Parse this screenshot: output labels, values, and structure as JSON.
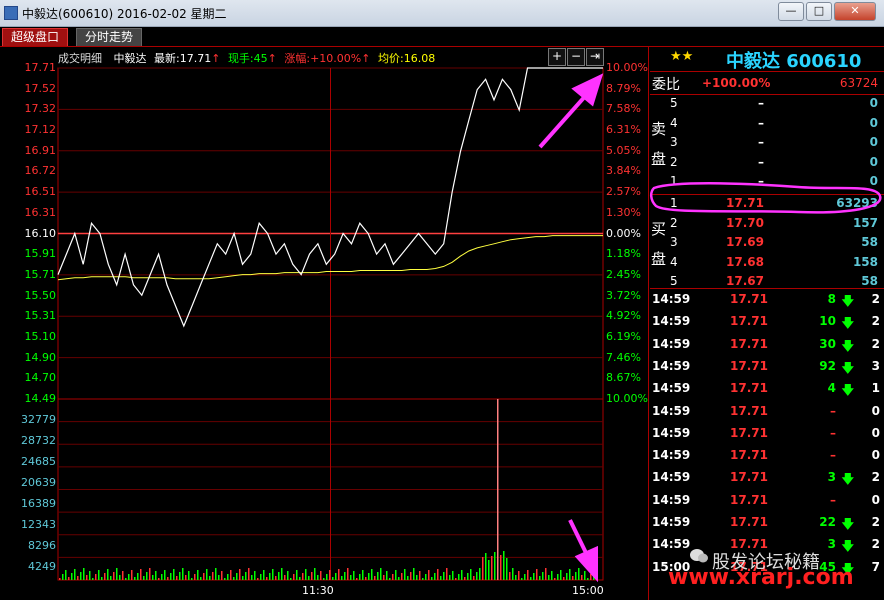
{
  "window": {
    "title": "中毅达(600610) 2016-02-02 星期二",
    "buttons": [
      "—",
      "□",
      "✕"
    ]
  },
  "tabs": [
    "超级盘口",
    "分时走势"
  ],
  "header": {
    "detail": "成交明细",
    "name": "中毅达",
    "latest_label": "最新:",
    "latest": "17.71",
    "vol_label": "现手:",
    "vol": "45",
    "chg_label": "涨幅:",
    "chg": "+10.00%",
    "avg_label": "均价:",
    "avg": "16.08",
    "controls": [
      "+",
      "−",
      "⇥"
    ]
  },
  "price_axis": [
    "17.71",
    "17.52",
    "17.32",
    "17.12",
    "16.91",
    "16.72",
    "16.51",
    "16.31",
    "16.10",
    "15.91",
    "15.71",
    "15.50",
    "15.31",
    "15.10",
    "14.90",
    "14.70",
    "14.49"
  ],
  "pct_axis": [
    "10.00%",
    "8.79%",
    "7.58%",
    "6.31%",
    "5.05%",
    "3.84%",
    "2.57%",
    "1.30%",
    "0.00%",
    "1.18%",
    "2.45%",
    "3.72%",
    "4.92%",
    "6.19%",
    "7.46%",
    "8.67%",
    "10.00%"
  ],
  "volume_axis": [
    "32779",
    "28732",
    "24685",
    "20639",
    "16389",
    "12343",
    "8296",
    "4249"
  ],
  "time_axis": [
    "11:30",
    "15:00"
  ],
  "chart_data": {
    "type": "line",
    "prev_close": 16.1,
    "ylim": [
      14.49,
      17.71
    ],
    "series": [
      {
        "values": [
          15.7,
          15.9,
          16.1,
          15.8,
          16.2,
          16.1,
          15.8,
          15.6,
          15.9,
          15.6,
          15.5,
          15.7,
          15.9,
          15.6,
          15.4,
          15.2,
          15.4,
          15.6,
          15.8,
          16.0,
          15.9,
          16.1,
          15.8,
          15.9,
          16.2,
          16.1,
          15.9,
          16.0,
          15.8,
          15.7,
          15.9,
          16.0,
          15.8,
          15.9,
          16.1,
          16.0,
          16.2,
          16.1,
          15.9,
          16.0,
          15.8,
          15.9,
          16.0,
          16.1,
          16.0,
          15.9,
          16.0,
          16.5,
          16.9,
          17.2,
          17.5,
          17.6,
          17.4,
          17.6,
          17.5,
          17.3,
          17.71,
          17.71,
          17.71,
          17.71,
          17.71,
          17.71,
          17.71,
          17.71,
          17.71,
          17.71
        ]
      },
      {
        "values": [
          15.65,
          15.66,
          15.67,
          15.67,
          15.68,
          15.68,
          15.68,
          15.68,
          15.68,
          15.67,
          15.67,
          15.67,
          15.67,
          15.67,
          15.66,
          15.66,
          15.66,
          15.66,
          15.66,
          15.67,
          15.68,
          15.69,
          15.7,
          15.7,
          15.71,
          15.71,
          15.71,
          15.72,
          15.72,
          15.72,
          15.72,
          15.72,
          15.73,
          15.73,
          15.73,
          15.73,
          15.74,
          15.74,
          15.74,
          15.74,
          15.74,
          15.74,
          15.75,
          15.75,
          15.75,
          15.76,
          15.78,
          15.82,
          15.88,
          15.93,
          15.96,
          15.98,
          16.0,
          16.02,
          16.04,
          16.05,
          16.06,
          16.07,
          16.07,
          16.08,
          16.08,
          16.08,
          16.08,
          16.08,
          16.08,
          16.08
        ]
      }
    ]
  },
  "quote": {
    "stars": "★★",
    "name_code": "中毅达 600610",
    "weibi_label": "委比",
    "weibi_pct": "+100.00%",
    "weibi_val": "63724",
    "sell_label": [
      "卖",
      "盘"
    ],
    "buy_label": [
      "买",
      "盘"
    ],
    "sell": [
      {
        "lvl": "5",
        "price": "–",
        "vol": "0"
      },
      {
        "lvl": "4",
        "price": "–",
        "vol": "0"
      },
      {
        "lvl": "3",
        "price": "–",
        "vol": "0"
      },
      {
        "lvl": "2",
        "price": "–",
        "vol": "0"
      },
      {
        "lvl": "1",
        "price": "–",
        "vol": "0"
      }
    ],
    "buy": [
      {
        "lvl": "1",
        "price": "17.71",
        "vol": "63293"
      },
      {
        "lvl": "2",
        "price": "17.70",
        "vol": "157"
      },
      {
        "lvl": "3",
        "price": "17.69",
        "vol": "58"
      },
      {
        "lvl": "4",
        "price": "17.68",
        "vol": "158"
      },
      {
        "lvl": "5",
        "price": "17.67",
        "vol": "58"
      }
    ]
  },
  "ticks": [
    {
      "time": "14:59",
      "price": "17.71",
      "vol": "8",
      "arrow": "down",
      "n": "2"
    },
    {
      "time": "14:59",
      "price": "17.71",
      "vol": "10",
      "arrow": "down",
      "n": "2"
    },
    {
      "time": "14:59",
      "price": "17.71",
      "vol": "30",
      "arrow": "down",
      "n": "2"
    },
    {
      "time": "14:59",
      "price": "17.71",
      "vol": "92",
      "arrow": "down",
      "n": "3"
    },
    {
      "time": "14:59",
      "price": "17.71",
      "vol": "4",
      "arrow": "down",
      "n": "1"
    },
    {
      "time": "14:59",
      "price": "17.71",
      "vol": "–",
      "arrow": "",
      "n": "0"
    },
    {
      "time": "14:59",
      "price": "17.71",
      "vol": "–",
      "arrow": "",
      "n": "0"
    },
    {
      "time": "14:59",
      "price": "17.71",
      "vol": "–",
      "arrow": "",
      "n": "0"
    },
    {
      "time": "14:59",
      "price": "17.71",
      "vol": "3",
      "arrow": "down",
      "n": "2"
    },
    {
      "time": "14:59",
      "price": "17.71",
      "vol": "–",
      "arrow": "",
      "n": "0"
    },
    {
      "time": "14:59",
      "price": "17.71",
      "vol": "22",
      "arrow": "down",
      "n": "2"
    },
    {
      "time": "14:59",
      "price": "17.71",
      "vol": "3",
      "arrow": "down",
      "n": "2"
    },
    {
      "time": "15:00",
      "price": "17.71",
      "vol": "45",
      "arrow": "down",
      "n": "7"
    }
  ],
  "watermark": {
    "text1": "股发论坛秘籍",
    "text2": "www.xrarj.com"
  },
  "colors": {
    "red": "#ff3232",
    "green": "#00ff00",
    "yellow": "#ffff00",
    "cyan": "#2ad4ff",
    "magenta": "#ff33ff"
  }
}
